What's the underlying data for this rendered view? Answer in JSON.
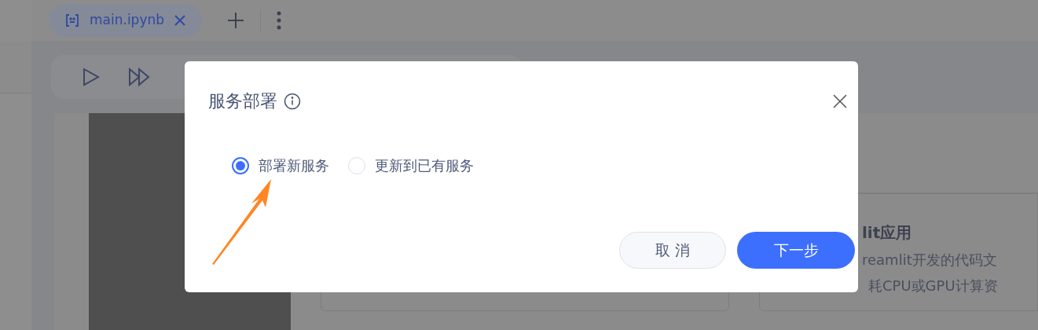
{
  "tabs": [
    {
      "label": "main.ipynb",
      "selected": true
    }
  ],
  "background_card": {
    "title": "lit应用",
    "lines": [
      "reamlit开发的代码文",
      "耗CPU或GPU计算资"
    ]
  },
  "dialog": {
    "title": "服务部署",
    "options": [
      {
        "label": "部署新服务",
        "selected": true
      },
      {
        "label": "更新到已有服务",
        "selected": false
      }
    ],
    "buttons": [
      {
        "label": "取 消",
        "kind": "secondary"
      },
      {
        "label": "下一步",
        "kind": "primary"
      }
    ]
  }
}
